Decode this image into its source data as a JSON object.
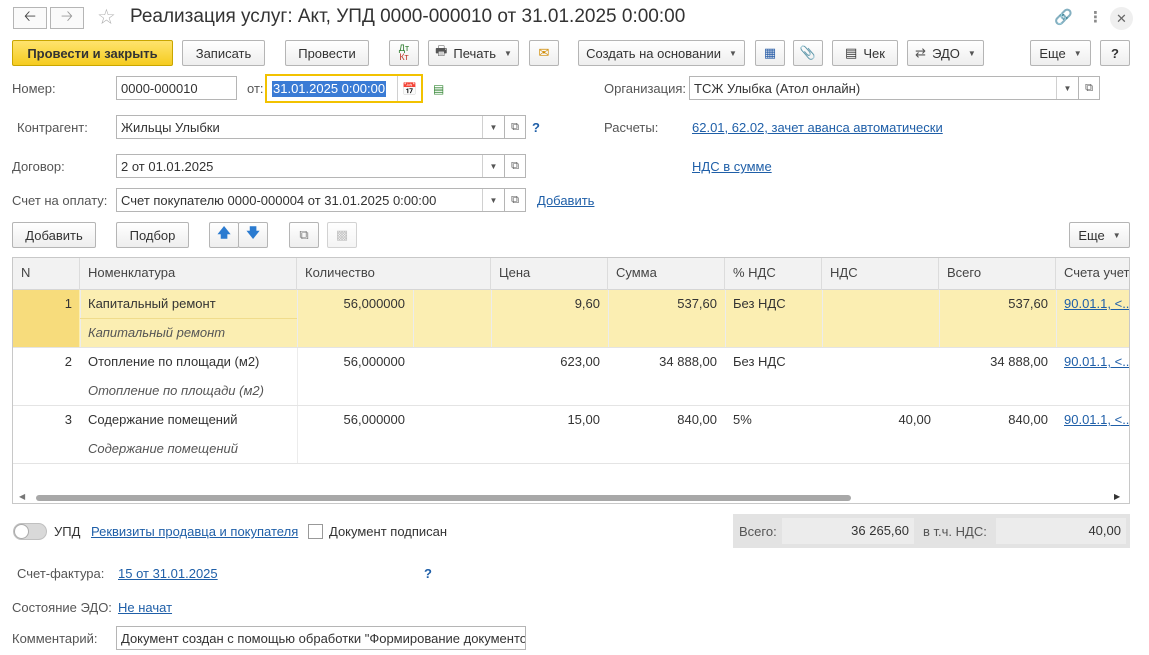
{
  "window": {
    "title": "Реализация услуг: Акт, УПД 0000-000010 от 31.01.2025 0:00:00"
  },
  "toolbar": {
    "post_close": "Провести и закрыть",
    "save": "Записать",
    "post": "Провести",
    "dtkt": "Дт Кт",
    "print": "Печать",
    "create_basis": "Создать на основании",
    "cheque": "Чек",
    "edo": "ЭДО",
    "more": "Еще",
    "help": "?"
  },
  "form": {
    "number_label": "Номер:",
    "number_value": "0000-000010",
    "from_label": "от:",
    "date_value": "31.01.2025  0:00:00",
    "org_label": "Организация:",
    "org_value": "ТСЖ Улыбка (Атол онлайн)",
    "contractor_label": "Контрагент:",
    "contractor_value": "Жильцы Улыбки",
    "settlements_label": "Расчеты:",
    "settlements_link": "62.01, 62.02, зачет аванса автоматически",
    "contract_label": "Договор:",
    "contract_value": "2 от 01.01.2025",
    "vat_link": "НДС в сумме",
    "invoice_label": "Счет на оплату:",
    "invoice_value": "Счет покупателю 0000-000004 от 31.01.2025 0:00:00",
    "add_link": "Добавить",
    "help_mark": "?"
  },
  "table_toolbar": {
    "add": "Добавить",
    "pick": "Подбор",
    "more": "Еще"
  },
  "table": {
    "columns": [
      "N",
      "Номенклатура",
      "Количество",
      "Цена",
      "Сумма",
      "% НДС",
      "НДС",
      "Всего",
      "Счета учет"
    ],
    "rows": [
      {
        "n": "1",
        "name": "Капитальный ремонт",
        "sub": "Капитальный ремонт",
        "qty": "56,000000",
        "price": "9,60",
        "sum": "537,60",
        "vat_rate": "Без НДС",
        "vat": "",
        "total": "537,60",
        "account": "90.01.1, <..."
      },
      {
        "n": "2",
        "name": "Отопление по площади (м2)",
        "sub": "Отопление по площади (м2)",
        "qty": "56,000000",
        "price": "623,00",
        "sum": "34 888,00",
        "vat_rate": "Без НДС",
        "vat": "",
        "total": "34 888,00",
        "account": "90.01.1, <..."
      },
      {
        "n": "3",
        "name": "Содержание помещений",
        "sub": "Содержание помещений",
        "qty": "56,000000",
        "price": "15,00",
        "sum": "840,00",
        "vat_rate": "5%",
        "vat": "40,00",
        "total": "840,00",
        "account": "90.01.1, <..."
      }
    ]
  },
  "footer": {
    "upd_label": "УПД",
    "requisites_link": "Реквизиты продавца и покупателя",
    "signed_label": "Документ подписан",
    "total_label": "Всего:",
    "total_value": "36 265,60",
    "vat_incl_label": "в т.ч. НДС:",
    "vat_incl_value": "40,00",
    "invoice_fact_label": "Счет-фактура:",
    "invoice_fact_link": "15 от 31.01.2025",
    "invoice_fact_help": "?",
    "edo_state_label": "Состояние ЭДО:",
    "edo_state_link": "Не начат",
    "comment_label": "Комментарий:",
    "comment_value": "Документ создан с помощью обработки \"Формирование документов"
  }
}
